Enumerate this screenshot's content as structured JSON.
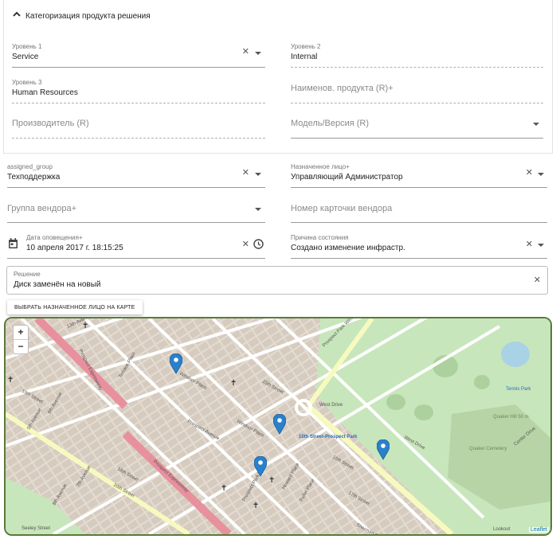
{
  "section": {
    "title": "Категоризация продукта решения"
  },
  "product": {
    "level1": {
      "label": "Уровень 1",
      "value": "Service"
    },
    "level2": {
      "label": "Уровень 2",
      "value": "Internal"
    },
    "level3": {
      "label": "Уровень 3",
      "value": "Human Resources"
    },
    "product_name": {
      "placeholder": "Наименов. продукта (R)+"
    },
    "manufacturer": {
      "placeholder": "Производитель (R)"
    },
    "model_version": {
      "placeholder": "Модель/Версия (R)"
    }
  },
  "assignment": {
    "assigned_group": {
      "label": "assigned_group",
      "value": "Техподдержка"
    },
    "assignee": {
      "label": "Назначенное лицо+",
      "value": "Управляющий Администратор"
    },
    "vendor_group": {
      "placeholder": "Группа вендора+"
    },
    "vendor_ticket": {
      "placeholder": "Номер карточки вендора"
    },
    "notify_date": {
      "label": "Дата оповещения+",
      "value": "10 апреля 2017 г. 18:15:25"
    },
    "status_reason": {
      "label": "Причина состояния",
      "value": "Создано изменение инфрастр."
    },
    "resolution": {
      "label": "Решение",
      "value": "Диск заменён на новый"
    }
  },
  "map": {
    "button_label": "ВЫБРАТЬ НАЗНАЧЕННОЕ ЛИЦО НА КАРТЕ",
    "zoom_in": "+",
    "zoom_out": "−",
    "attribution": "Leaflet",
    "marker_color": "#2a81cb",
    "labels": {
      "prospect_park_west": "Prospect Park West",
      "prospect_expressway_1": "Prospect Expressway",
      "prospect_expressway_2": "Prospect Expressway",
      "st15_prospect_park": "15th Street-Prospect Park",
      "quaker_hill": "Quaker Hill 50 m",
      "quaker_cemetery": "Quaker Cemetery",
      "tennis": "Tennis Park",
      "west_drive_1": "West Drive",
      "west_drive_2": "West Drive",
      "center_drive": "Center Drive",
      "windsor_place_1": "Windsor Place",
      "windsor_place_2": "Windsor Place",
      "prospect_avenue": "Prospect Avenue",
      "st15": "15th Street",
      "st16": "16th Street",
      "st17": "17th Street",
      "st18": "18th Street",
      "st19": "19th Street",
      "st20": "20th Street",
      "st13": "13th Avenue",
      "ave5": "5th Avenue",
      "ave6": "6th Avenue",
      "ave7": "7th Avenue",
      "ave8": "8th Avenue",
      "seeley": "Seeley Street",
      "howard": "Howard Place",
      "fuller": "Fuller Place",
      "sherman": "Sherman Street",
      "terrace": "Terrace Place",
      "prospect_park": "Prospect Park West",
      "lookout": "Lookout"
    }
  },
  "icons": {
    "chevron": "chevron-up-icon",
    "clear": "close-icon",
    "dropdown": "caret-down-icon",
    "calendar": "calendar-icon",
    "clock": "clock-icon",
    "marker": "map-marker-icon"
  }
}
